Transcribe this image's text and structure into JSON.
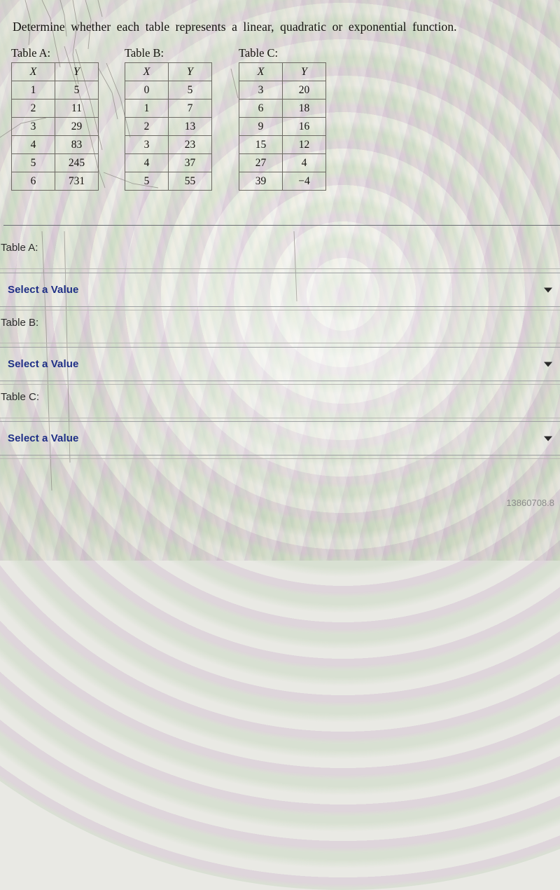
{
  "prompt": "Determine whether each table represents a linear, quadratic or exponential function.",
  "tables": [
    {
      "title": "Table A:",
      "headers": [
        "X",
        "Y"
      ],
      "rows": [
        [
          "1",
          "5"
        ],
        [
          "2",
          "11"
        ],
        [
          "3",
          "29"
        ],
        [
          "4",
          "83"
        ],
        [
          "5",
          "245"
        ],
        [
          "6",
          "731"
        ]
      ]
    },
    {
      "title": "Table B:",
      "headers": [
        "X",
        "Y"
      ],
      "rows": [
        [
          "0",
          "5"
        ],
        [
          "1",
          "7"
        ],
        [
          "2",
          "13"
        ],
        [
          "3",
          "23"
        ],
        [
          "4",
          "37"
        ],
        [
          "5",
          "55"
        ]
      ]
    },
    {
      "title": "Table C:",
      "headers": [
        "X",
        "Y"
      ],
      "rows": [
        [
          "3",
          "20"
        ],
        [
          "6",
          "18"
        ],
        [
          "9",
          "16"
        ],
        [
          "15",
          "12"
        ],
        [
          "27",
          "4"
        ],
        [
          "39",
          "−4"
        ]
      ]
    }
  ],
  "answers": [
    {
      "label": "Table A:",
      "selected": "Select a Value",
      "arrow_icon": "chevron-down-icon"
    },
    {
      "label": "Table B:",
      "selected": "Select a Value",
      "arrow_icon": "chevron-down-icon"
    },
    {
      "label": "Table C:",
      "selected": "Select a Value",
      "arrow_icon": "chevron-down-icon"
    }
  ],
  "watermark": "13860708.8",
  "colors": {
    "select_text": "#1f2f86",
    "divider": "#6a6d72",
    "table_border": "#6d6a63",
    "page_bg": "#e9e9e4"
  }
}
